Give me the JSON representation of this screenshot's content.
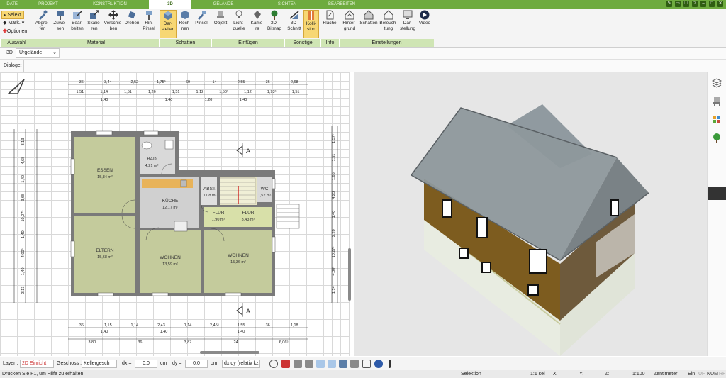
{
  "tabs": [
    "DATEI",
    "PROJEKT",
    "KONSTRUKTION",
    "3D",
    "GELÄNDE",
    "SICHTEN",
    "BEARBEITEN"
  ],
  "selection": {
    "select": "Selekt",
    "mark": "Mark.",
    "options": "Optionen"
  },
  "ribbon": {
    "material": [
      "Abgrei-\nfen",
      "Zuwei-\nsen",
      "Bear-\nbeiten",
      "Skalie-\nren",
      "Verschie-\nben",
      "Drehen",
      "Hin.\nPinsel"
    ],
    "schatten": [
      "Dar-\nstellen",
      "Rech-\nnen",
      "Pinsel"
    ],
    "einfuegen": [
      "Objekt",
      "Licht-\nquelle",
      "Kame-\nra",
      "3D-\nBitmap"
    ],
    "sonstige": [
      "3D-\nSchnitt",
      "Kolli-\nsion"
    ],
    "info": [
      "Fläche"
    ],
    "einstellungen": [
      "Hinter-\ngrund",
      "Schatten",
      "Beleuch-\ntung",
      "Dar-\nstellung",
      "Video"
    ],
    "groups": [
      "Auswahl",
      "Material",
      "Schatten",
      "Einfügen",
      "Sonstige",
      "Info",
      "Einstellungen"
    ]
  },
  "view": {
    "mode": "3D",
    "terrain": "Urgelände",
    "dialog_label": "Dialoge:"
  },
  "rooms": [
    {
      "name": "ESSEN",
      "area": "15,84 m²"
    },
    {
      "name": "BAD",
      "area": "4,21 m²"
    },
    {
      "name": "KÜCHE",
      "area": "12,17 m²"
    },
    {
      "name": "ABST.",
      "area": "1,08 m²"
    },
    {
      "name": "WC",
      "area": "1,52 m²"
    },
    {
      "name": "FLUR",
      "area": "1,90 m²"
    },
    {
      "name": "FLUR",
      "area": "3,43 m²"
    },
    {
      "name": "ELTERN",
      "area": "15,68 m²"
    },
    {
      "name": "WOHNEN",
      "area": "13,59 m²"
    },
    {
      "name": "WOHNEN",
      "area": "15,36 m²"
    }
  ],
  "dims_top1": [
    "36",
    "3,44",
    "2,52",
    "1,75⁵",
    "69",
    "14",
    "2,55",
    "36",
    "2,68"
  ],
  "dims_top2": [
    "1,51",
    "1,14",
    "1,51",
    "1,26",
    "1,51",
    "1,12",
    "1,50⁵",
    "1,12",
    "1,93⁵",
    "1,51"
  ],
  "dims_top2b": [
    "1,40",
    "1,40",
    "1,20",
    "1,40"
  ],
  "dims_bottom1": [
    "36",
    "1,15",
    "1,14",
    "2,43",
    "1,14",
    "2,45⁵",
    "1,55",
    "36",
    "1,18"
  ],
  "dims_bottom1b": [
    "1,40",
    "1,40",
    "1,40"
  ],
  "dims_bottom2": [
    "3,80",
    "36",
    "3,87",
    "24",
    "6,06⁵"
  ],
  "dims_left": [
    "3,13",
    "4,68",
    "1,40",
    "3,68",
    "10,27⁵",
    "1,40",
    "4,00⁵",
    "1,40",
    "3,13"
  ],
  "dims_right": [
    "1,37⁵",
    "1,51",
    "1,65",
    "4,23",
    "1,40",
    "2,20",
    "10,27⁵",
    "4,00⁵",
    "1,14"
  ],
  "section_marker": "A",
  "bottombar": {
    "layer_label": "Layer :",
    "layer_value": "2D Einricht",
    "floor_label": "Geschoss :",
    "floor_value": "Kellergesch",
    "dx_label": "dx =",
    "dx_value": "0,0",
    "dy_label": "dy =",
    "dy_value": "0,0",
    "unit": "cm",
    "mode_value": "dx,dy (relativ kz"
  },
  "status": {
    "help": "Drücken Sie F1, um Hilfe zu erhalten.",
    "selection": "Selektion",
    "count": "1:1 sel",
    "x": "X:",
    "y": "Y:",
    "z": "Z:",
    "scale": "1:100",
    "unit": "Zentimeter",
    "ein": "Ein",
    "uf": "UF",
    "num": "NUM",
    "rf": "RF"
  },
  "colors": {
    "accent": "#6eab3f",
    "room_fill": "#c4cb9c",
    "wall": "#7a7a7a",
    "roof": "#8c9599",
    "facade": "#7d5c1f"
  }
}
